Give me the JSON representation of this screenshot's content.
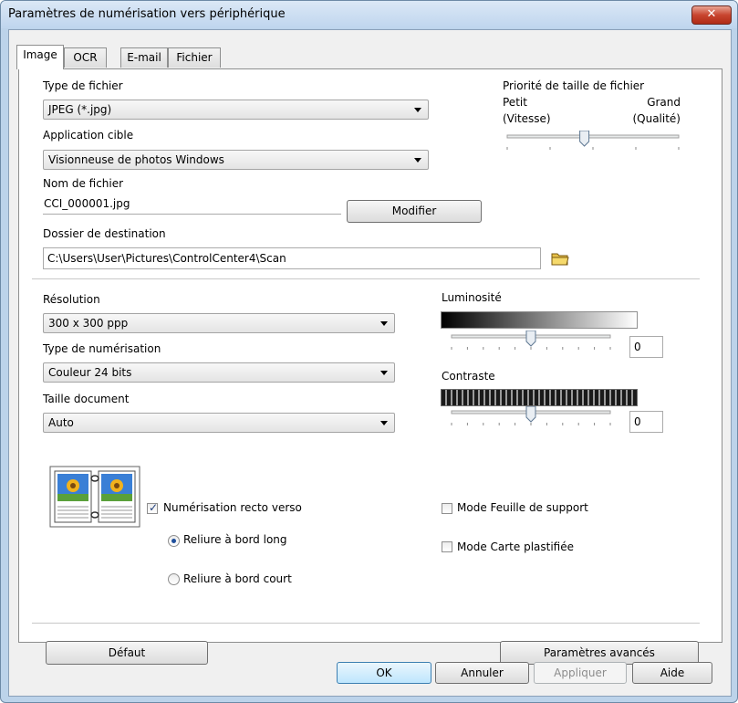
{
  "window": {
    "title": "Paramètres de numérisation vers périphérique",
    "close_icon": "close-icon"
  },
  "tabs": [
    {
      "label": "Image",
      "active": true
    },
    {
      "label": "OCR",
      "active": false
    },
    {
      "label": "E-mail",
      "active": false
    },
    {
      "label": "Fichier",
      "active": false
    }
  ],
  "file_type": {
    "label": "Type de fichier",
    "value": "JPEG (*.jpg)"
  },
  "target_app": {
    "label": "Application cible",
    "value": "Visionneuse de photos Windows"
  },
  "file_name": {
    "label": "Nom de fichier",
    "value": "CCI_000001.jpg",
    "modify_label": "Modifier"
  },
  "destination": {
    "label": "Dossier de destination",
    "value": "C:\\Users\\User\\Pictures\\ControlCenter4\\Scan",
    "folder_icon": "folder-icon"
  },
  "file_size": {
    "title": "Priorité de taille de fichier",
    "left_top": "Petit",
    "left_bottom": "(Vitesse)",
    "right_top": "Grand",
    "right_bottom": "(Qualité)",
    "level": 0.45
  },
  "resolution": {
    "label": "Résolution",
    "value": "300 x 300 ppp"
  },
  "scan_type": {
    "label": "Type de numérisation",
    "value": "Couleur 24 bits"
  },
  "doc_size": {
    "label": "Taille document",
    "value": "Auto"
  },
  "brightness": {
    "label": "Luminosité",
    "value": "0",
    "level": 0.5
  },
  "contrast": {
    "label": "Contraste",
    "value": "0",
    "level": 0.5
  },
  "duplex": {
    "label": "Numérisation recto verso",
    "checked": true,
    "long_edge": "Reliure à bord long",
    "short_edge": "Reliure à bord court",
    "selected": "long_edge"
  },
  "carrier_sheet": {
    "label": "Mode Feuille de support",
    "checked": false
  },
  "plastic_card": {
    "label": "Mode Carte plastifiée",
    "checked": false
  },
  "buttons": {
    "default": "Défaut",
    "advanced": "Paramètres avancés",
    "ok": "OK",
    "cancel": "Annuler",
    "apply": "Appliquer",
    "help": "Aide"
  }
}
